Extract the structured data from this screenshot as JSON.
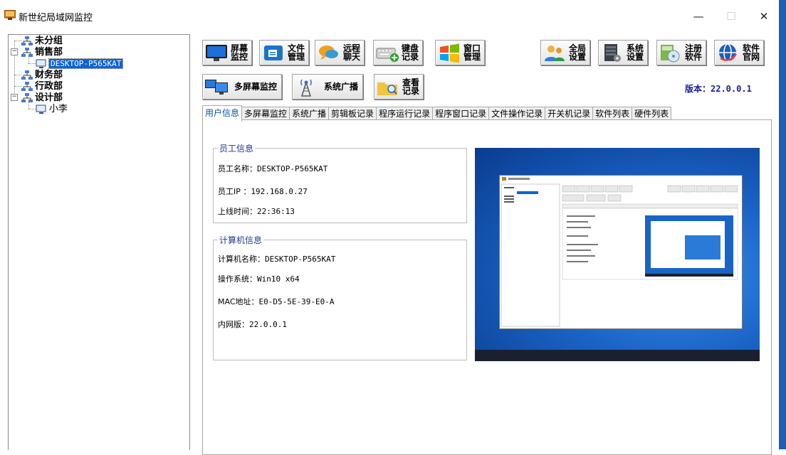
{
  "window": {
    "title": "新世纪局域网监控",
    "minimize": "—",
    "maximize": "☐",
    "close": "✕"
  },
  "tree": {
    "groups": [
      {
        "label": "未分组"
      },
      {
        "label": "销售部",
        "children": [
          {
            "label": "DESKTOP-P565KAT",
            "selected": true
          }
        ]
      },
      {
        "label": "财务部"
      },
      {
        "label": "行政部"
      },
      {
        "label": "设计部",
        "children": [
          {
            "label": "小李"
          }
        ]
      }
    ]
  },
  "toolbar": {
    "screen_monitor": "屏幕监控",
    "file_manage": "文件管理",
    "remote_chat": "远程聊天",
    "keyboard_log": "键盘记录",
    "window_manage": "窗口管理",
    "global_settings": "全局设置",
    "system_settings": "系统设置",
    "register": "注册软件",
    "website": "软件官网",
    "multi_screen": "多屏幕监控",
    "broadcast": "系统广播",
    "view_log": "查看记录"
  },
  "version": "版本：22.0.0.1",
  "tabs": [
    "用户信息",
    "多屏幕监控",
    "系统广播",
    "剪辑板记录",
    "程序运行记录",
    "程序窗口记录",
    "文件操作记录",
    "开关机记录",
    "软件列表",
    "硬件列表"
  ],
  "employee": {
    "title": "员工信息",
    "name_label": "员工名称：",
    "name": "DESKTOP-P565KAT",
    "ip_label": "员工IP ：",
    "ip": "192.168.0.27",
    "online_label": "上线时间：",
    "online_time": "22:36:13"
  },
  "computer": {
    "title": "计算机信息",
    "name_label": "计算机名称：",
    "name": "DESKTOP-P565KAT",
    "os_label": "操作系统：",
    "os": "Win10 x64",
    "mac_label": "MAC地址：",
    "mac": "E0-D5-5E-39-E0-A",
    "lan_label": "内网版：",
    "lan_version": "22.0.0.1"
  },
  "colors": {
    "accent": "#0b50b0",
    "selection": "#0a64d6",
    "desktop": "#1a64c6"
  }
}
